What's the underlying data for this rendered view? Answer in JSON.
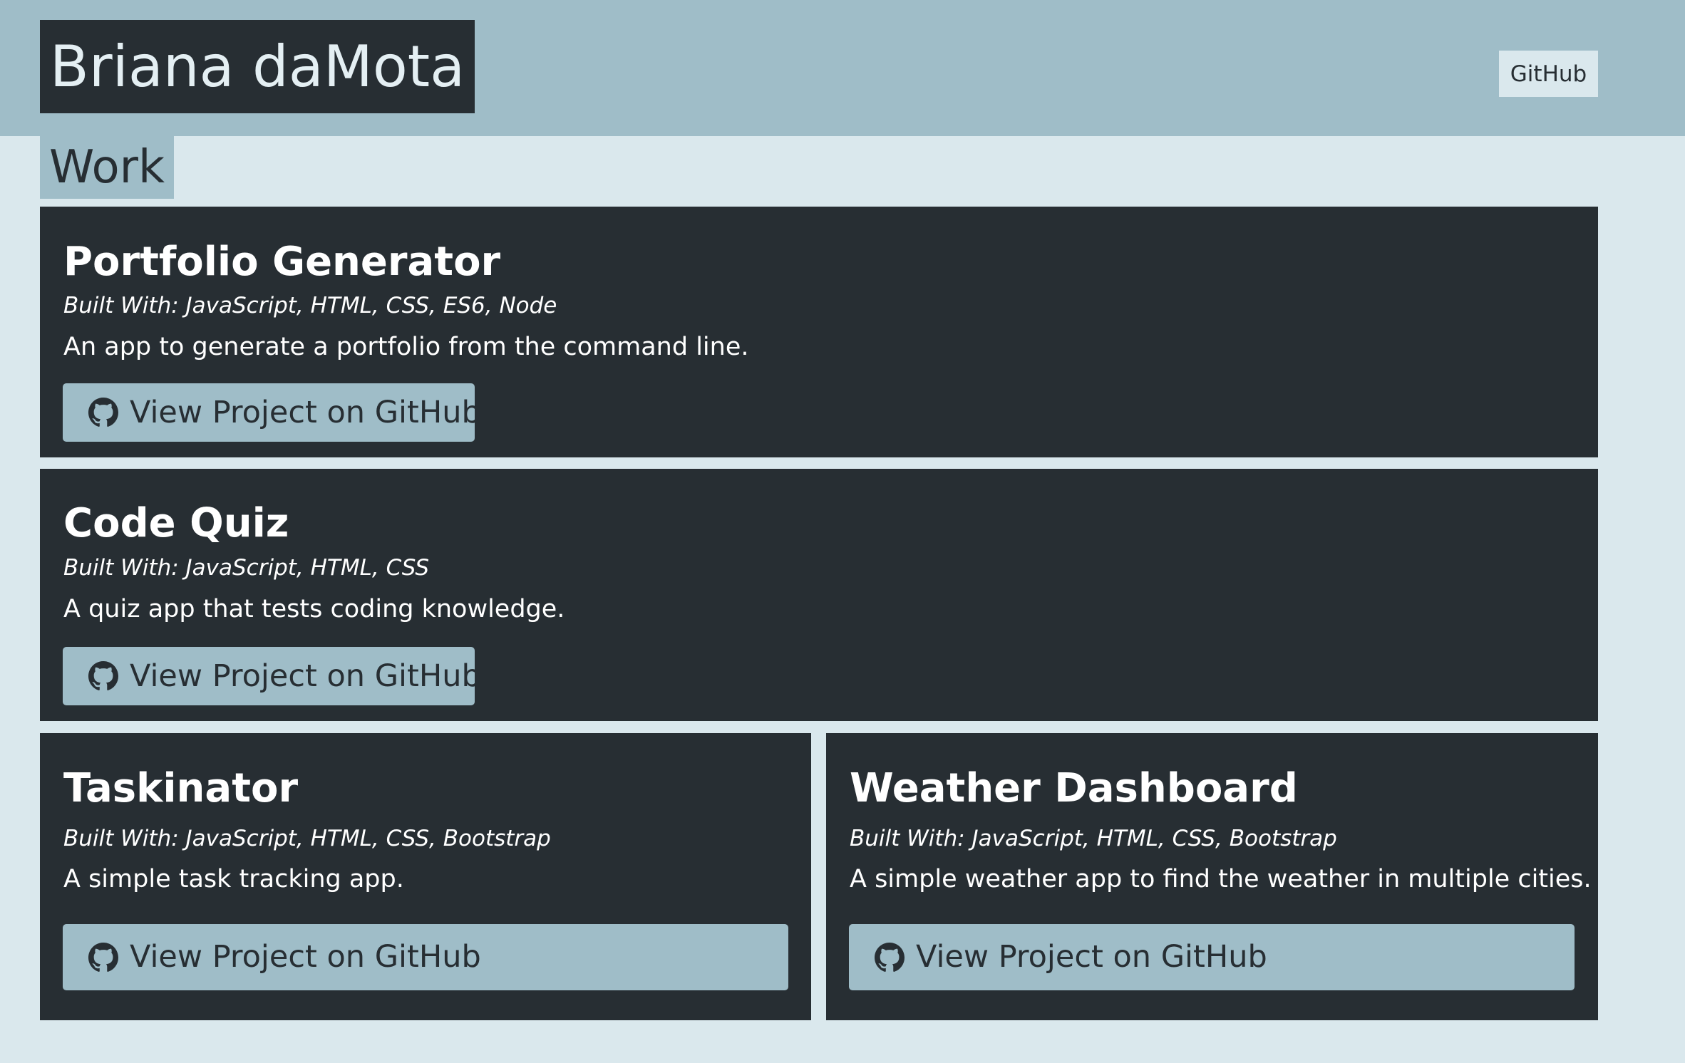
{
  "header": {
    "name": "Briana daMota",
    "nav_link": "GitHub"
  },
  "section": {
    "title": "Work"
  },
  "colors": {
    "page_background": "#dae8ed",
    "header_background": "#9fbdc8",
    "card_background": "#272e33",
    "button_background": "#9fbdc8",
    "text_dark": "#272e33",
    "text_light": "#ffffff"
  },
  "projects": [
    {
      "title": "Portfolio Generator",
      "built_with": "Built With: JavaScript, HTML, CSS, ES6, Node",
      "description": "An app to generate a portfolio from the command line.",
      "button_label": "View Project on GitHub",
      "button_icon": "github-icon"
    },
    {
      "title": "Code Quiz",
      "built_with": "Built With: JavaScript, HTML, CSS",
      "description": "A quiz app that tests coding knowledge.",
      "button_label": "View Project on GitHub",
      "button_icon": "github-icon"
    },
    {
      "title": "Taskinator",
      "built_with": "Built With: JavaScript, HTML, CSS, Bootstrap",
      "description": "A simple task tracking app.",
      "button_label": "View Project on GitHub",
      "button_icon": "github-icon"
    },
    {
      "title": "Weather Dashboard",
      "built_with": "Built With: JavaScript, HTML, CSS, Bootstrap",
      "description": "A simple weather app to find the weather in multiple cities.",
      "button_label": "View Project on GitHub",
      "button_icon": "github-icon"
    }
  ]
}
